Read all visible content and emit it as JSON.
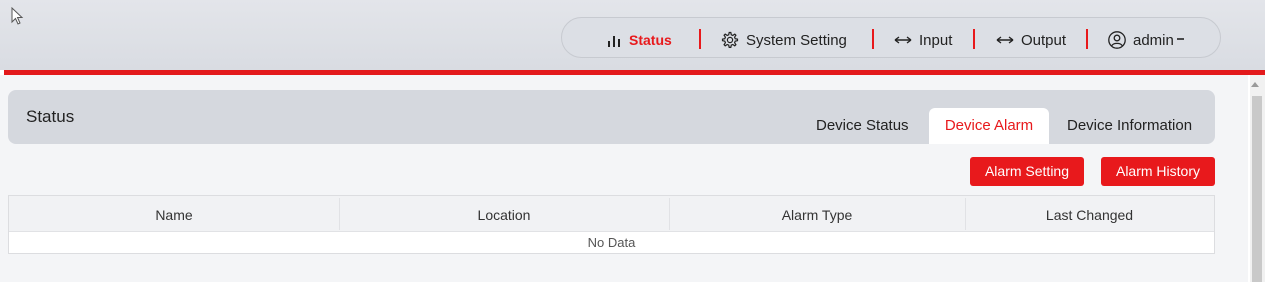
{
  "nav": {
    "status": "Status",
    "system_setting": "System Setting",
    "input": "Input",
    "output": "Output",
    "user": "admin"
  },
  "panel": {
    "title": "Status",
    "tabs": [
      "Device Status",
      "Device Alarm",
      "Device Information"
    ],
    "active_tab": "Device Alarm"
  },
  "buttons": {
    "alarm_setting": "Alarm Setting",
    "alarm_history": "Alarm History"
  },
  "table": {
    "columns": [
      "Name",
      "Location",
      "Alarm Type",
      "Last Changed"
    ],
    "rows": [],
    "empty_text": "No Data"
  },
  "icons": {
    "status": "bar-chart-icon",
    "system_setting": "gear-icon",
    "input": "double-arrow-icon",
    "output": "double-arrow-icon",
    "user": "user-circle-icon",
    "user_menu": "caret-down-icon"
  },
  "colors": {
    "accent": "#e8191c",
    "header_bg": "#dcdfe5",
    "panel_bg": "#d5d8de"
  }
}
